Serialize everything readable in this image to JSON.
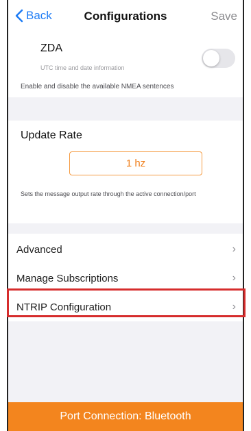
{
  "nav": {
    "back_label": "Back",
    "title": "Configurations",
    "save_label": "Save"
  },
  "zda": {
    "title": "ZDA",
    "subtitle": "UTC time and date information",
    "toggle_on": false,
    "caption": "Enable and disable the available NMEA sentences"
  },
  "update_rate": {
    "title": "Update Rate",
    "value": "1 hz",
    "caption": "Sets the message output rate through the active connection/port"
  },
  "menu": {
    "items": [
      {
        "label": "Advanced"
      },
      {
        "label": "Manage Subscriptions"
      },
      {
        "label": "NTRIP Configuration"
      }
    ]
  },
  "bottom": {
    "label": "Port Connection: Bluetooth"
  },
  "colors": {
    "accent": "#f3851e",
    "link": "#1e7cf5",
    "highlight": "#d62c2c"
  }
}
